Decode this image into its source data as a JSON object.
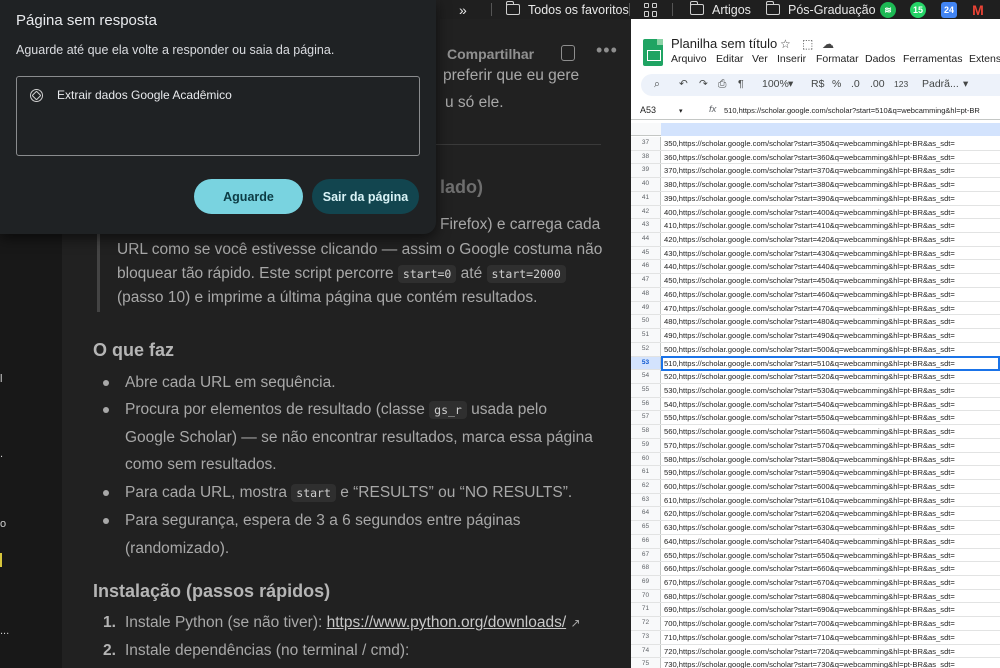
{
  "bookmarks": {
    "chevron": "»",
    "items": [
      {
        "label": "Todos os favoritos"
      },
      {
        "label": "Artigos"
      },
      {
        "label": "Pós-Graduação"
      }
    ],
    "badge_count": "15"
  },
  "chat": {
    "share_label": "Compartilhar",
    "top_partial_1": "preferir que eu gere",
    "top_partial_2": "u só ele.",
    "heading_partial": "lado)",
    "para_partial_1": "Firefox) e carrega cada",
    "para_line_2": "URL como se você estivesse clicando — assim o Google costuma não",
    "para_line_3_prefix": "bloquear tão rápido. Este script percorre",
    "code_start0": "start=0",
    "para_line_3_mid": "até",
    "code_start2000": "start=2000",
    "para_line_4": "(passo 10) e imprime a última página que contém resultados.",
    "section1_title": "O que faz",
    "bullets": [
      "Abre cada URL em sequência.",
      "Procura por elementos de resultado (classe",
      "usada pelo",
      "Google Scholar) — se não encontrar resultados, marca essa página",
      "como sem resultados.",
      "Para cada URL, mostra",
      "e “RESULTS” ou “NO RESULTS”.",
      "Para segurança, espera de 3 a 6 segundos entre páginas",
      "(randomizado)."
    ],
    "code_gs_r": "gs_r",
    "code_start": "start",
    "section2_title": "Instalação (passos rápidos)",
    "steps": [
      {
        "num": "1.",
        "text": "Instale Python (se não tiver):",
        "link": "https://www.python.org/downloads/"
      },
      {
        "num": "2.",
        "text": "Instale dependências (no terminal / cmd):"
      }
    ],
    "sidebar_stubs": [
      "l",
      ".",
      "o",
      "..."
    ]
  },
  "dialog": {
    "title": "Página sem resposta",
    "message": "Aguarde até que ela volte a responder ou saia da página.",
    "tab_item": "Extrair dados Google Acadêmico",
    "wait_button": "Aguarde",
    "exit_button": "Sair da página"
  },
  "sheets": {
    "title": "Planilha sem título",
    "menu": [
      "Arquivo",
      "Editar",
      "Ver",
      "Inserir",
      "Formatar",
      "Dados",
      "Ferramentas",
      "Extensõ"
    ],
    "toolbar": {
      "zoom": "100%",
      "currency": "R$",
      "percent": "%",
      "dec_less": ".0",
      "dec_more": ".00",
      "num_format": "123",
      "font": "Padrã..."
    },
    "cell_ref": "A53",
    "fx": "fx",
    "formula_value": "510,https://scholar.google.com/scholar?start=510&q=webcamming&hl=pt-BR",
    "rows": [
      {
        "n": "37",
        "v": "350,https://scholar.google.com/scholar?start=350&q=webcamming&hl=pt-BR&as_sdt="
      },
      {
        "n": "38",
        "v": "360,https://scholar.google.com/scholar?start=360&q=webcamming&hl=pt-BR&as_sdt="
      },
      {
        "n": "39",
        "v": "370,https://scholar.google.com/scholar?start=370&q=webcamming&hl=pt-BR&as_sdt="
      },
      {
        "n": "40",
        "v": "380,https://scholar.google.com/scholar?start=380&q=webcamming&hl=pt-BR&as_sdt="
      },
      {
        "n": "41",
        "v": "390,https://scholar.google.com/scholar?start=390&q=webcamming&hl=pt-BR&as_sdt="
      },
      {
        "n": "42",
        "v": "400,https://scholar.google.com/scholar?start=400&q=webcamming&hl=pt-BR&as_sdt="
      },
      {
        "n": "43",
        "v": "410,https://scholar.google.com/scholar?start=410&q=webcamming&hl=pt-BR&as_sdt="
      },
      {
        "n": "44",
        "v": "420,https://scholar.google.com/scholar?start=420&q=webcamming&hl=pt-BR&as_sdt="
      },
      {
        "n": "45",
        "v": "430,https://scholar.google.com/scholar?start=430&q=webcamming&hl=pt-BR&as_sdt="
      },
      {
        "n": "46",
        "v": "440,https://scholar.google.com/scholar?start=440&q=webcamming&hl=pt-BR&as_sdt="
      },
      {
        "n": "47",
        "v": "450,https://scholar.google.com/scholar?start=450&q=webcamming&hl=pt-BR&as_sdt="
      },
      {
        "n": "48",
        "v": "460,https://scholar.google.com/scholar?start=460&q=webcamming&hl=pt-BR&as_sdt="
      },
      {
        "n": "49",
        "v": "470,https://scholar.google.com/scholar?start=470&q=webcamming&hl=pt-BR&as_sdt="
      },
      {
        "n": "50",
        "v": "480,https://scholar.google.com/scholar?start=480&q=webcamming&hl=pt-BR&as_sdt="
      },
      {
        "n": "51",
        "v": "490,https://scholar.google.com/scholar?start=490&q=webcamming&hl=pt-BR&as_sdt="
      },
      {
        "n": "52",
        "v": "500,https://scholar.google.com/scholar?start=500&q=webcamming&hl=pt-BR&as_sdt="
      },
      {
        "n": "53",
        "v": "510,https://scholar.google.com/scholar?start=510&q=webcamming&hl=pt-BR&as_sdt=",
        "selected": true
      },
      {
        "n": "54",
        "v": "520,https://scholar.google.com/scholar?start=520&q=webcamming&hl=pt-BR&as_sdt="
      },
      {
        "n": "55",
        "v": "530,https://scholar.google.com/scholar?start=530&q=webcamming&hl=pt-BR&as_sdt="
      },
      {
        "n": "56",
        "v": "540,https://scholar.google.com/scholar?start=540&q=webcamming&hl=pt-BR&as_sdt="
      },
      {
        "n": "57",
        "v": "550,https://scholar.google.com/scholar?start=550&q=webcamming&hl=pt-BR&as_sdt="
      },
      {
        "n": "58",
        "v": "560,https://scholar.google.com/scholar?start=560&q=webcamming&hl=pt-BR&as_sdt="
      },
      {
        "n": "59",
        "v": "570,https://scholar.google.com/scholar?start=570&q=webcamming&hl=pt-BR&as_sdt="
      },
      {
        "n": "60",
        "v": "580,https://scholar.google.com/scholar?start=580&q=webcamming&hl=pt-BR&as_sdt="
      },
      {
        "n": "61",
        "v": "590,https://scholar.google.com/scholar?start=590&q=webcamming&hl=pt-BR&as_sdt="
      },
      {
        "n": "62",
        "v": "600,https://scholar.google.com/scholar?start=600&q=webcamming&hl=pt-BR&as_sdt="
      },
      {
        "n": "63",
        "v": "610,https://scholar.google.com/scholar?start=610&q=webcamming&hl=pt-BR&as_sdt="
      },
      {
        "n": "64",
        "v": "620,https://scholar.google.com/scholar?start=620&q=webcamming&hl=pt-BR&as_sdt="
      },
      {
        "n": "65",
        "v": "630,https://scholar.google.com/scholar?start=630&q=webcamming&hl=pt-BR&as_sdt="
      },
      {
        "n": "66",
        "v": "640,https://scholar.google.com/scholar?start=640&q=webcamming&hl=pt-BR&as_sdt="
      },
      {
        "n": "67",
        "v": "650,https://scholar.google.com/scholar?start=650&q=webcamming&hl=pt-BR&as_sdt="
      },
      {
        "n": "68",
        "v": "660,https://scholar.google.com/scholar?start=660&q=webcamming&hl=pt-BR&as_sdt="
      },
      {
        "n": "69",
        "v": "670,https://scholar.google.com/scholar?start=670&q=webcamming&hl=pt-BR&as_sdt="
      },
      {
        "n": "70",
        "v": "680,https://scholar.google.com/scholar?start=680&q=webcamming&hl=pt-BR&as_sdt="
      },
      {
        "n": "71",
        "v": "690,https://scholar.google.com/scholar?start=690&q=webcamming&hl=pt-BR&as_sdt="
      },
      {
        "n": "72",
        "v": "700,https://scholar.google.com/scholar?start=700&q=webcamming&hl=pt-BR&as_sdt="
      },
      {
        "n": "73",
        "v": "710,https://scholar.google.com/scholar?start=710&q=webcamming&hl=pt-BR&as_sdt="
      },
      {
        "n": "74",
        "v": "720,https://scholar.google.com/scholar?start=720&q=webcamming&hl=pt-BR&as_sdt="
      },
      {
        "n": "75",
        "v": "730,https://scholar.google.com/scholar?start=730&q=webcamming&hl=pt-BR&as_sdt="
      }
    ]
  },
  "colors": {
    "accent_wait": "#79d3e0",
    "accent_exit": "#12454f",
    "sheets_green": "#1fa463",
    "selection": "#1a73e8"
  }
}
